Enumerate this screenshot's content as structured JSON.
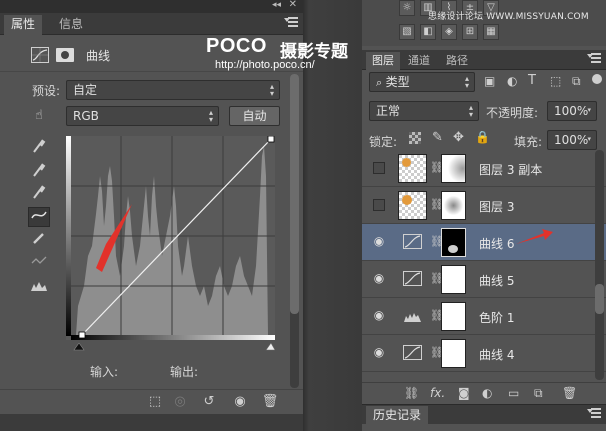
{
  "properties_panel": {
    "tabs": [
      "属性",
      "信息"
    ],
    "title": "曲线",
    "preset_label": "预设:",
    "preset_value": "自定",
    "channel_value": "RGB",
    "auto_label": "自动",
    "input_label": "输入:",
    "output_label": "输出:"
  },
  "watermark": {
    "brand": "POCO",
    "subtitle": "摄影专题",
    "url": "http://photo.poco.cn/"
  },
  "layers_panel": {
    "top_watermark": "思缘设计论坛 WWW.MISSYUAN.COM",
    "tabs": [
      "图层",
      "通道",
      "路径"
    ],
    "filter_label": "类型",
    "blend_mode": "正常",
    "opacity_label": "不透明度:",
    "opacity_value": "100%",
    "lock_label": "锁定:",
    "fill_label": "填充:",
    "fill_value": "100%",
    "layers": [
      {
        "name": "图层 3 副本",
        "visible": false,
        "kind": "pixel",
        "selected": false
      },
      {
        "name": "图层 3",
        "visible": false,
        "kind": "pixel",
        "selected": false
      },
      {
        "name": "曲线 6",
        "visible": true,
        "kind": "curves",
        "selected": true
      },
      {
        "name": "曲线 5",
        "visible": true,
        "kind": "curves",
        "selected": false
      },
      {
        "name": "色阶 1",
        "visible": true,
        "kind": "levels",
        "selected": false
      },
      {
        "name": "曲线 4",
        "visible": true,
        "kind": "curves",
        "selected": false
      }
    ]
  },
  "history_panel": {
    "tab": "历史记录"
  },
  "colors": {
    "panel_bg": "#535353",
    "selected_row": "#5a6b86",
    "arrow_red": "#e2322b"
  }
}
